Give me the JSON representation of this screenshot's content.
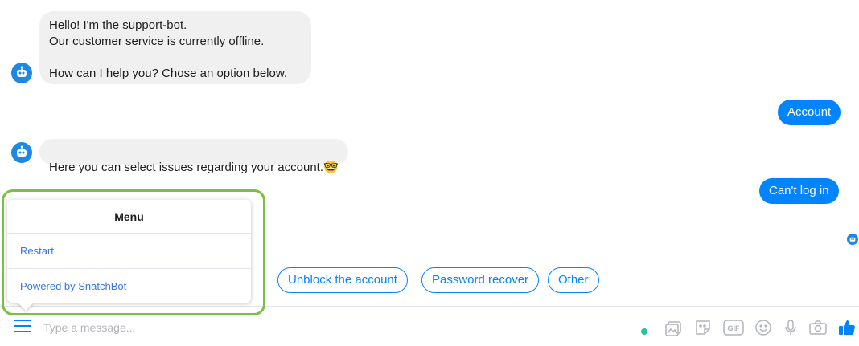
{
  "messages": [
    {
      "from": "bot",
      "text": "Hello! I'm the support-bot.\nOur customer service is currently offline.\n\nHow can I help you? Chose an option below."
    },
    {
      "from": "user",
      "text": "Account"
    },
    {
      "from": "bot",
      "text": "Here you can select issues regarding your account.",
      "emoji": "🤓"
    },
    {
      "from": "user",
      "text": "Can't log in"
    }
  ],
  "quick_replies": [
    "Unblock the account",
    "Password recover",
    "Other"
  ],
  "menu": {
    "title": "Menu",
    "items": [
      "Restart",
      "Powered by SnatchBot"
    ]
  },
  "composer": {
    "placeholder": "Type a message...",
    "icons": [
      "menu-icon",
      "image-icon",
      "sticker-icon",
      "gif-icon",
      "emoji-icon",
      "microphone-icon",
      "camera-icon",
      "thumbs-up-icon"
    ]
  },
  "colors": {
    "accent": "#0084ff",
    "bot_bubble": "#f1f0f0",
    "highlight": "#7ac143",
    "status_dot": "#20c997"
  }
}
